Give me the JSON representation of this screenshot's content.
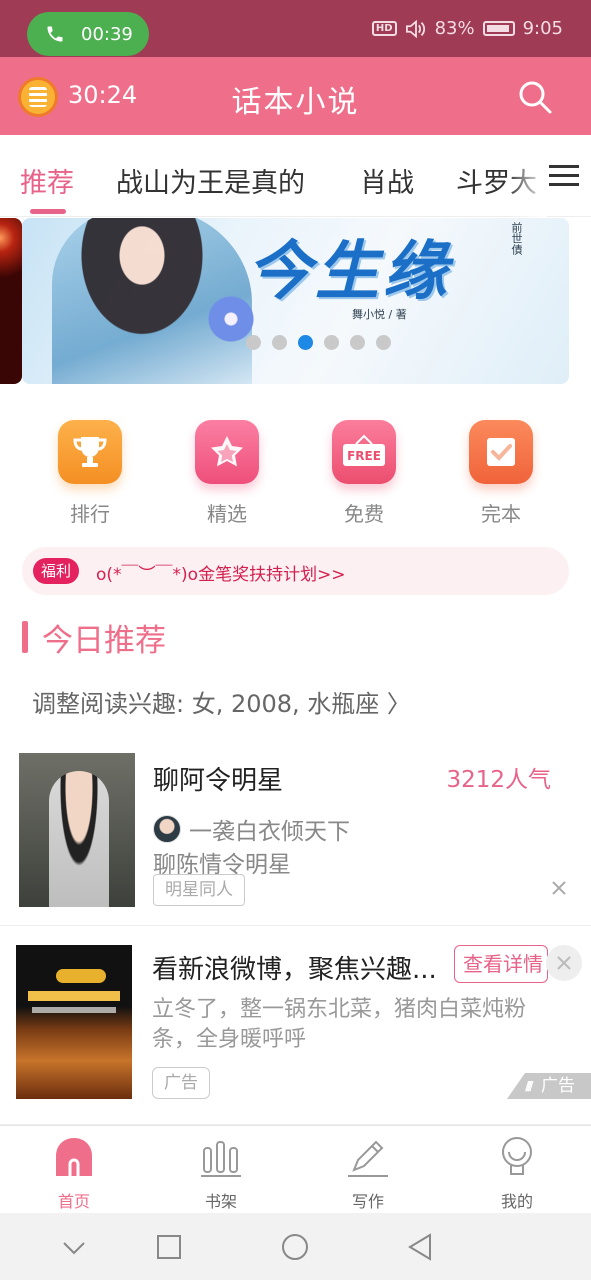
{
  "status_bar": {
    "call_time": "00:39",
    "hd": "HD",
    "battery": "83%",
    "time": "9:05"
  },
  "app_bar": {
    "timer": "30:24",
    "title": "话本小说",
    "colors": {
      "brand": "#ef6f8b",
      "status_bar": "#a03b55"
    }
  },
  "tabs": [
    {
      "label": "推荐",
      "active": true
    },
    {
      "label": "战山为王是真的",
      "active": false
    },
    {
      "label": "肖战",
      "active": false
    },
    {
      "label": "斗罗大",
      "active": false
    }
  ],
  "banner": {
    "title": "今生缘",
    "author": "舞小悦 / 著",
    "subtitle": "前世債",
    "dot_count": 6,
    "active_dot_index": 2
  },
  "categories": [
    {
      "label": "排行",
      "icon": "trophy-icon"
    },
    {
      "label": "精选",
      "icon": "star-icon"
    },
    {
      "label": "免费",
      "icon": "free-sign-icon",
      "icon_text": "FREE"
    },
    {
      "label": "完本",
      "icon": "checkmark-icon"
    }
  ],
  "welfare": {
    "tag": "福利",
    "text": "o(*￣︶￣*)o金笔奖扶持计划>>"
  },
  "section": {
    "title": "今日推荐",
    "preference": "调整阅读兴趣: 女, 2008, 水瓶座 〉"
  },
  "feed": [
    {
      "title": "聊阿令明星",
      "popularity": "3212人气",
      "author": "一袭白衣倾天下",
      "description": "聊陈情令明星",
      "tag": "明星同人"
    },
    {
      "title": "看新浪微博，聚焦兴趣...",
      "button": "查看详情",
      "description": "立冬了，整一锅东北菜，猪肉白菜炖粉条，全身暖呼呼",
      "tag": "广告",
      "ad_mark": "广告"
    }
  ],
  "bottom_nav": [
    {
      "label": "首页",
      "icon": "home-icon",
      "active": true
    },
    {
      "label": "书架",
      "icon": "bookshelf-icon",
      "active": false
    },
    {
      "label": "写作",
      "icon": "pen-icon",
      "active": false
    },
    {
      "label": "我的",
      "icon": "profile-icon",
      "active": false
    }
  ]
}
